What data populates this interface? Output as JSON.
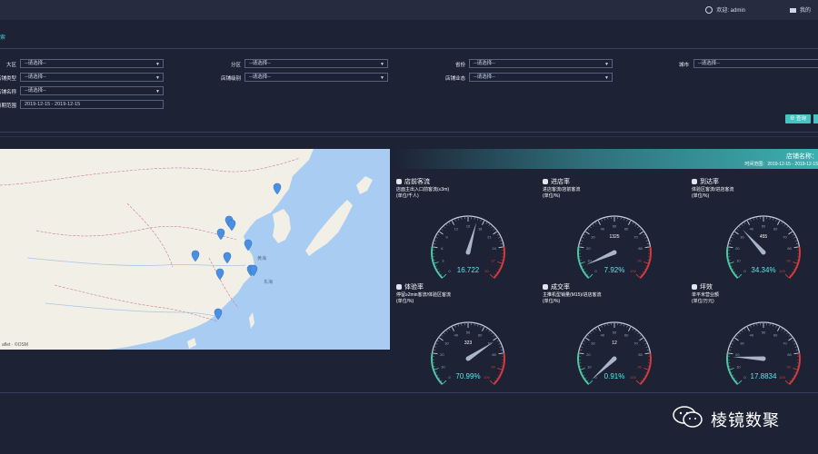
{
  "header": {
    "welcome": "欢迎: admin",
    "mine": "我的"
  },
  "breadcrumb": "索",
  "filters": {
    "row1": [
      {
        "label": "大区",
        "value": "--请选择--"
      },
      {
        "label": "分区",
        "value": "--请选择--"
      },
      {
        "label": "省份",
        "value": "--请选择--"
      },
      {
        "label": "城市",
        "value": "--请选择--"
      }
    ],
    "row2": [
      {
        "label": "店铺类型",
        "value": "--请选择--"
      },
      {
        "label": "店铺级别",
        "value": "--请选择--"
      },
      {
        "label": "店铺业态",
        "value": "--请选择--"
      }
    ],
    "row3": [
      {
        "label": "店铺名称",
        "value": "--请选择--"
      }
    ],
    "row4": [
      {
        "label": "日期范围",
        "value": "2019-12-15 - 2019-12-15"
      }
    ],
    "query_button": "⊕ 查询"
  },
  "map": {
    "attribution": "aflet · ©OSM",
    "pins": 11,
    "labels": [
      "黄海",
      "东海"
    ]
  },
  "panel": {
    "title": "店铺名称：",
    "time": "时间范围：2019-12-15 - 2019-12-15"
  },
  "gauges": [
    {
      "title": "店前客流",
      "icon": "people-icon",
      "desc1": "店面主出入口前客流(≤3m)",
      "desc2": "(单位/千人)",
      "value": "16.722",
      "max_label": "30",
      "ticks": [
        "0",
        "3",
        "6",
        "9",
        "12",
        "15",
        "18",
        "21",
        "24",
        "27",
        "30"
      ],
      "fraction": 0.557
    },
    {
      "title": "进店率",
      "icon": "store-icon",
      "desc1": "进店客流/店前客流",
      "desc2": "(单位/%)",
      "value": "7.92%",
      "max_label": "100",
      "ticks": [
        "0",
        "10",
        "20",
        "30",
        "40",
        "50",
        "60",
        "70",
        "80",
        "90",
        "100"
      ],
      "fraction": 0.0792,
      "center_text": "1325"
    },
    {
      "title": "到达率",
      "icon": "pie-icon",
      "desc1": "体验区客流/进店客流",
      "desc2": "(单位/%)",
      "value": "34.34%",
      "max_label": "100",
      "ticks": [
        "0",
        "10",
        "20",
        "30",
        "40",
        "50",
        "60",
        "70",
        "80",
        "90",
        "100"
      ],
      "fraction": 0.3434,
      "center_text": "455"
    },
    {
      "title": "体验率",
      "icon": "wrench-icon",
      "desc1": "停留≥2min客流/体验区客流",
      "desc2": "(单位/%)",
      "value": "70.99%",
      "max_label": "100",
      "ticks": [
        "0",
        "10",
        "20",
        "30",
        "40",
        "50",
        "60",
        "70",
        "80",
        "90",
        "100"
      ],
      "fraction": 0.7099,
      "center_text": "323"
    },
    {
      "title": "成交率",
      "icon": "handshake-icon",
      "desc1": "主推机型销量(M15)/进店客流",
      "desc2": "(单位/%)",
      "value": "0.91%",
      "max_label": "100",
      "ticks": [
        "0",
        "10",
        "20",
        "30",
        "40",
        "50",
        "60",
        "70",
        "80",
        "90",
        "100"
      ],
      "fraction": 0.0091,
      "center_text": "12"
    },
    {
      "title": "坪效",
      "icon": "home-icon",
      "desc1": "单平米营业额",
      "desc2": "(单位/万元)",
      "value": "17.8834",
      "max_label": "100",
      "ticks": [
        "0",
        "10",
        "20",
        "30",
        "40",
        "50",
        "60",
        "70",
        "80",
        "90",
        "100"
      ],
      "fraction": 0.178834
    }
  ],
  "watermark": "棱镜数聚",
  "colors": {
    "teal": "#3fd0c9",
    "gauge_red": "#d23c3c",
    "gauge_green": "#4ec7a2",
    "value": "#5ee7e7"
  }
}
